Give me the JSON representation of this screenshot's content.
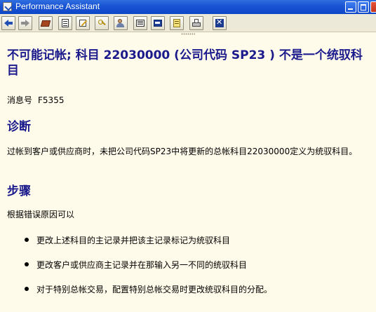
{
  "window": {
    "title": "Performance Assistant"
  },
  "toolbar": {
    "buttons": [
      "back",
      "forward",
      "help-library",
      "technical-info",
      "edit",
      "keys",
      "users",
      "document",
      "info-panel",
      "notes",
      "print",
      "close"
    ]
  },
  "content": {
    "heading": "不可能记帐; 科目  22030000 (公司代码  SP23 ) 不是一个统驭科目",
    "message_number_label": "消息号",
    "message_number": "F5355",
    "diagnosis_title": "诊断",
    "diagnosis_text": "过帐到客户或供应商时，未把公司代码SP23中将更新的总帐科目22030000定义为统驭科目。",
    "procedure_title": "步骤",
    "procedure_intro": "根据错误原因可以",
    "procedure_items": [
      "更改上述科目的主记录并把该主记录标记为统驭科目",
      "更改客户或供应商主记录并在那输入另一不同的统驭科目",
      "对于特别总帐交易，配置特别总帐交易时更改统驭科目的分配。"
    ]
  },
  "colors": {
    "background": "#fffbea",
    "heading": "#1a1a8c",
    "titlebar": "#1a55d4",
    "toolbar": "#ece9d8"
  }
}
